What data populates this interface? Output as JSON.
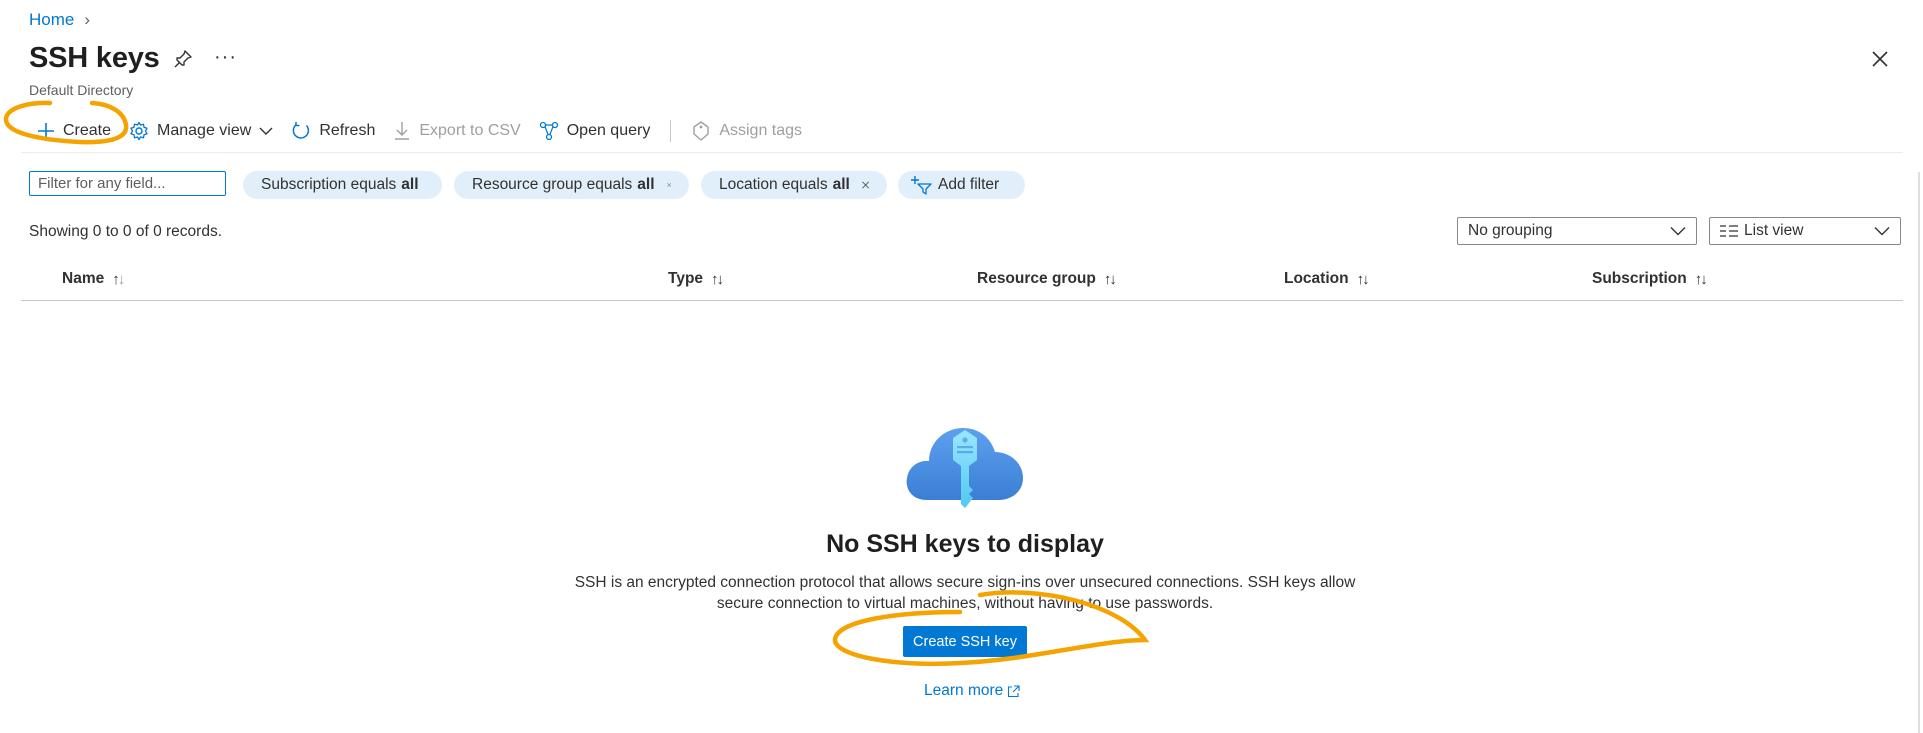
{
  "breadcrumb": {
    "home": "Home",
    "separator": "›"
  },
  "page": {
    "title": "SSH keys",
    "subtitle": "Default Directory",
    "more": "···"
  },
  "toolbar": {
    "create": "Create",
    "manage_view": "Manage view",
    "refresh": "Refresh",
    "export_csv": "Export to CSV",
    "open_query": "Open query",
    "assign_tags": "Assign tags"
  },
  "filters": {
    "placeholder": "Filter for any field...",
    "pills": [
      {
        "label": "Subscription equals",
        "value": "all"
      },
      {
        "label": "Resource group equals",
        "value": "all"
      },
      {
        "label": "Location equals",
        "value": "all"
      }
    ],
    "add_filter": "Add filter"
  },
  "records": {
    "count_text": "Showing 0 to 0 of 0 records."
  },
  "grouping": {
    "selected": "No grouping"
  },
  "view": {
    "selected": "List view"
  },
  "table": {
    "columns": [
      "Name",
      "Type",
      "Resource group",
      "Location",
      "Subscription"
    ],
    "rows": []
  },
  "empty": {
    "title": "No SSH keys to display",
    "description_line1": "SSH is an encrypted connection protocol that allows secure sign-ins over unsecured connections. SSH keys allow",
    "description_line2": "secure connection to virtual machines, without having to use passwords.",
    "cta": "Create SSH key",
    "learn_more": "Learn more"
  },
  "colors": {
    "accent": "#0078d4",
    "pill_bg": "#e1effa",
    "annotation": "#f5a300",
    "text": "#323130",
    "muted": "#605e5c"
  },
  "icons": [
    "chevron-right-icon",
    "pin-icon",
    "more-icon",
    "close-icon",
    "plus-icon",
    "gear-icon",
    "chevron-down-icon",
    "refresh-icon",
    "download-icon",
    "query-icon",
    "tag-icon",
    "clear-icon",
    "add-filter-icon",
    "list-icon",
    "sort-icon",
    "ssh-key-cloud-icon",
    "external-link-icon"
  ]
}
